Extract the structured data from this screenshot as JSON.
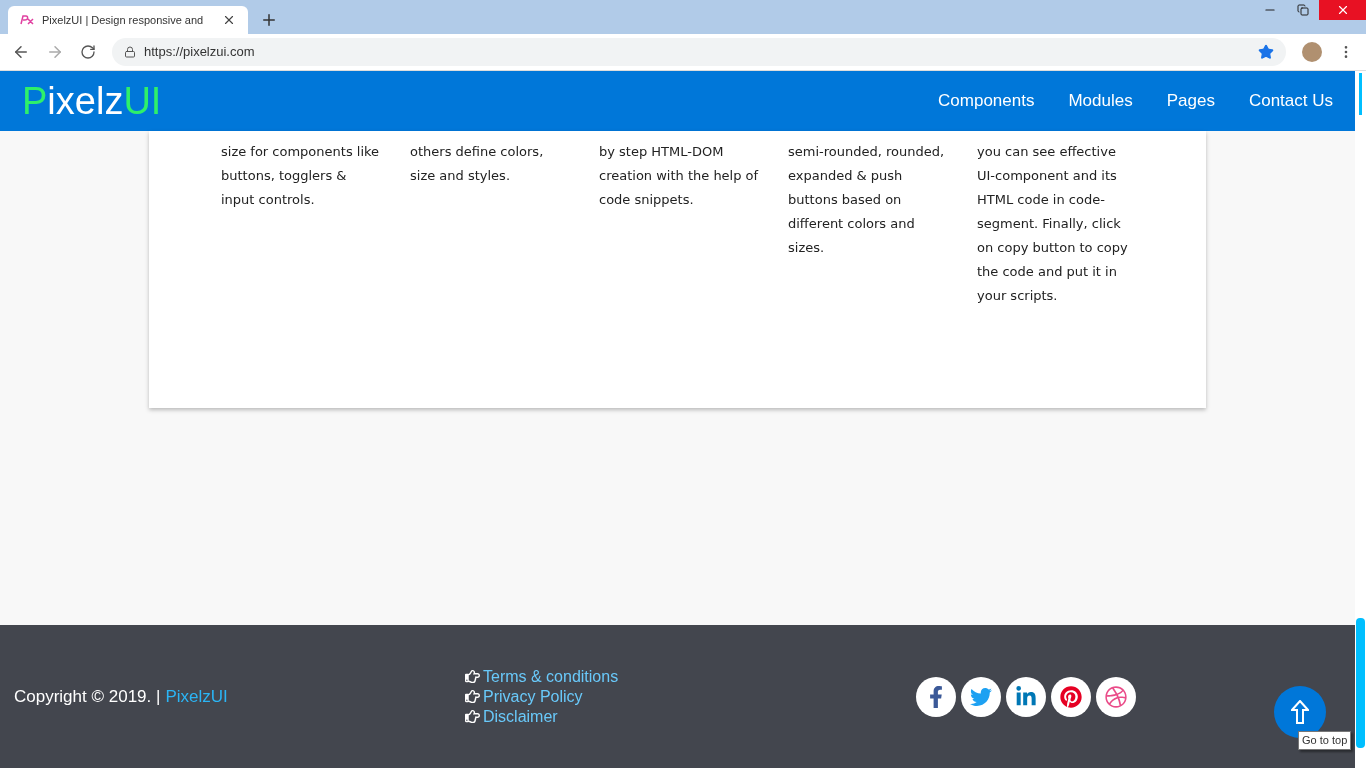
{
  "browser": {
    "tab_title": "PixelzUI | Design responsive and",
    "url": "https://pixelzui.com"
  },
  "navbar": {
    "logo": {
      "lead": "P",
      "middle": "ixelz",
      "tail": "UI"
    },
    "links": [
      {
        "label": "Components"
      },
      {
        "label": "Modules"
      },
      {
        "label": "Pages"
      },
      {
        "label": "Contact Us"
      }
    ]
  },
  "features": [
    {
      "text": "size for components like buttons, togglers & input controls."
    },
    {
      "text": "others define colors, size and styles."
    },
    {
      "text": "by step HTML-DOM creation with the help of code snippets."
    },
    {
      "text": "semi-rounded, rounded, expanded & push buttons based on different colors and sizes."
    },
    {
      "text": "you can see effective UI-component and its HTML code in code-segment. Finally, click on copy button to copy the code and put it in your scripts."
    }
  ],
  "footer": {
    "copyright": "Copyright © 2019. |",
    "brand": "PixelzUI",
    "links": [
      {
        "label": "Terms & conditions"
      },
      {
        "label": "Privacy Policy"
      },
      {
        "label": "Disclaimer"
      }
    ],
    "social": [
      {
        "kind": "facebook"
      },
      {
        "kind": "twitter"
      },
      {
        "kind": "linkedin"
      },
      {
        "kind": "pinterest"
      },
      {
        "kind": "dribbble"
      }
    ]
  },
  "go_to_top": {
    "tooltip": "Go to top"
  }
}
